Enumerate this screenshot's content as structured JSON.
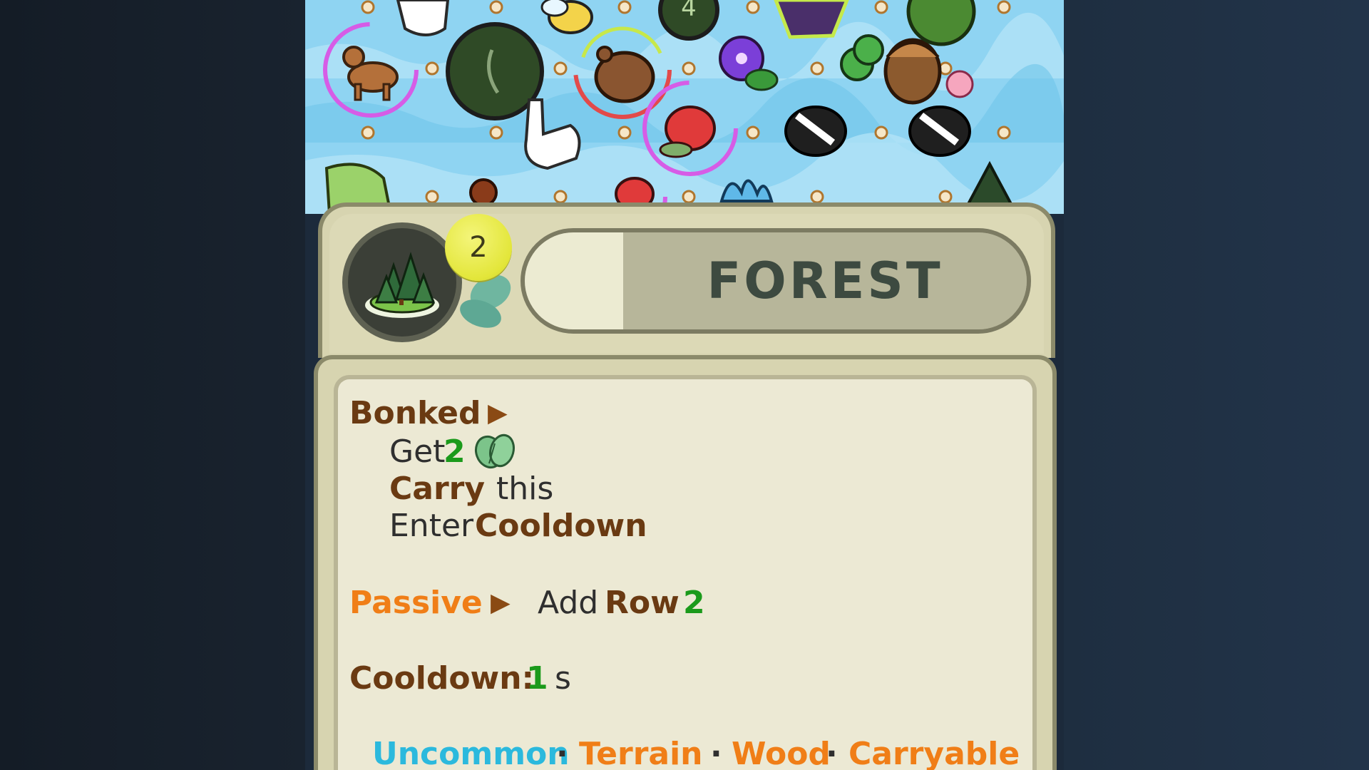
{
  "card": {
    "title": "FOREST",
    "level": "2",
    "icon": "forest-icon"
  },
  "abilities": {
    "trigger": "Bonked",
    "trigger_arrow": "▶",
    "line1_prefix": "Get",
    "line1_amount": "2",
    "line1_icon": "leaf-resource-icon",
    "line2_keyword": "Carry",
    "line2_suffix": "this",
    "line3_prefix": "Enter",
    "line3_keyword": "Cooldown",
    "passive_label": "Passive",
    "passive_arrow": "▶",
    "passive_text": "Add",
    "passive_keyword": "Row",
    "passive_amount": "2",
    "cooldown_label": "Cooldown:",
    "cooldown_value": "1",
    "cooldown_unit": "s"
  },
  "tags": {
    "rarity": "Uncommon",
    "t1": "Terrain",
    "t2": "Wood",
    "t3": "Carryable",
    "sep": "·"
  },
  "board": {
    "badge_number": "4"
  },
  "colors": {
    "brown": "#6a3a12",
    "green": "#1b9a1b",
    "orange": "#f07e17",
    "cyan": "#2bb9dd",
    "card_bg": "#ece9d4",
    "board_water": "#8fd4f2"
  }
}
